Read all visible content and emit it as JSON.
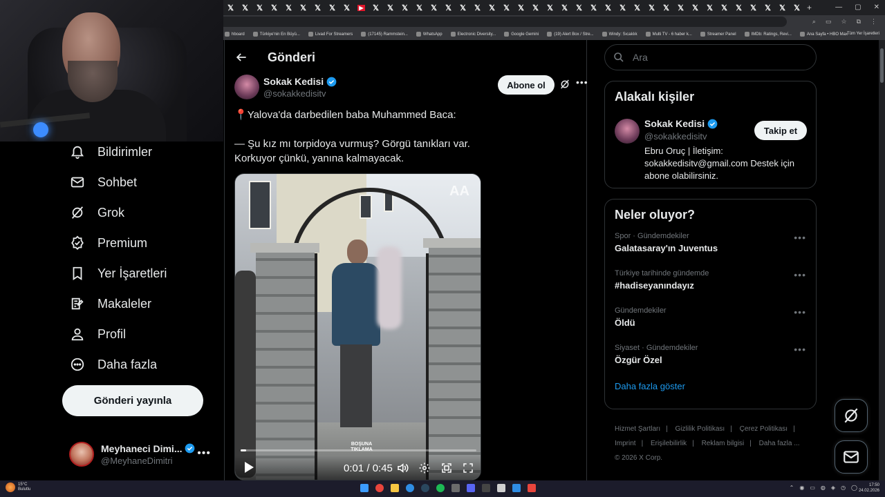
{
  "browser": {
    "tab_count": 40,
    "bookmarks": [
      "hboard",
      "Türkiye'nin En Büyü...",
      "Livad For Streamers",
      "(17145) Rammstein...",
      "WhatsApp",
      "Electronic Diversity...",
      "Google Gemini",
      "(19) Alert Box / Stre...",
      "Windy: Sıcaklık",
      "Multi TV - 6 haber k...",
      "Streamer Panel",
      "IMDb: Ratings, Revi...",
      "Ana Sayfa • HBO Max"
    ],
    "all_bookmarks": "Tüm Yer İşaretleri"
  },
  "nav": {
    "items": [
      {
        "label": "Bildirimler",
        "icon": "bell-icon"
      },
      {
        "label": "Sohbet",
        "icon": "mail-icon"
      },
      {
        "label": "Grok",
        "icon": "grok-icon"
      },
      {
        "label": "Premium",
        "icon": "premium-icon"
      },
      {
        "label": "Yer İşaretleri",
        "icon": "bookmark-icon"
      },
      {
        "label": "Makaleler",
        "icon": "article-icon"
      },
      {
        "label": "Profil",
        "icon": "profile-icon"
      },
      {
        "label": "Daha fazla",
        "icon": "more-circle-icon"
      }
    ],
    "post_button": "Gönderi yayınla",
    "account": {
      "name": "Meyhaneci Dimi...",
      "handle": "@MeyhaneDimitri"
    }
  },
  "post": {
    "header_title": "Gönderi",
    "author_name": "Sokak Kedisi",
    "author_handle": "@sokakkedisitv",
    "subscribe_label": "Abone ol",
    "text_line1": "Yalova'da darbedilen baba Muhammed Baca:",
    "text_line2": "— Şu kız mı torpidoya vurmuş? Görgü tanıkları var.",
    "text_line3": "Korkuyor çünkü, yanına kalmayacak.",
    "video": {
      "logo": "AA",
      "watermark": "BOŞUNA TIKLAMA",
      "time": "0:01 / 0:45",
      "progress": 0.022
    }
  },
  "right": {
    "search_placeholder": "Ara",
    "related": {
      "title": "Alakalı kişiler",
      "name": "Sokak Kedisi",
      "handle": "@sokakkedisitv",
      "follow_label": "Takip et",
      "bio": "Ebru Oruç | İletişim: sokakkedisitv@gmail.com Destek için abone olabilirsiniz."
    },
    "trends": {
      "title": "Neler oluyor?",
      "items": [
        {
          "category": "Spor · Gündemdekiler",
          "name": "Galatasaray'ın Juventus"
        },
        {
          "category": "Türkiye tarihinde gündemde",
          "name": "#hadiseyanındayız"
        },
        {
          "category": "Gündemdekiler",
          "name": "Öldü"
        },
        {
          "category": "Siyaset · Gündemdekiler",
          "name": "Özgür Özel"
        }
      ],
      "show_more": "Daha fazla göster"
    },
    "footer": {
      "links": [
        "Hizmet Şartları",
        "Gizlilik Politikası",
        "Çerez Politikası",
        "Imprint",
        "Erişilebilirlik",
        "Reklam bilgisi",
        "Daha fazla ..."
      ],
      "copyright": "© 2026 X Corp."
    }
  },
  "taskbar": {
    "weather_temp": "15°C",
    "weather_desc": "Bulutlu",
    "time": "17:50",
    "date": "24.02.2026"
  },
  "colors": {
    "accent": "#1d9bf0",
    "verified": "#1d9bf0",
    "background": "#000000",
    "border": "#2f3336"
  }
}
